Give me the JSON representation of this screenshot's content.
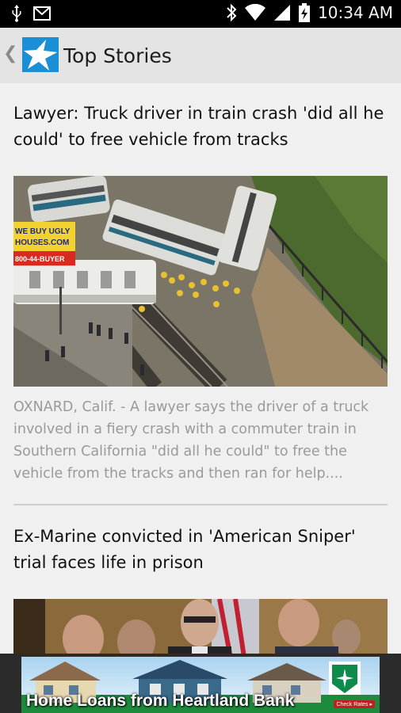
{
  "status_bar": {
    "time": "10:34 AM",
    "icons": [
      "usb-icon",
      "gmail-icon",
      "bluetooth-icon",
      "wifi-icon",
      "signal-icon",
      "battery-charging-icon"
    ]
  },
  "app_bar": {
    "back_glyph": "❮",
    "title": "Top Stories",
    "logo": "app-logo-star"
  },
  "stories": [
    {
      "headline": "Lawyer: Truck driver in train crash 'did all he could' to free vehicle from tracks",
      "image": "train-crash-aerial-photo",
      "sign_line1": "WE BUY UGLY",
      "sign_line2": "HOUSES.COM",
      "sign_line3": "800-44-BUYER",
      "summary": "OXNARD, Calif. - A lawyer says the driver of a truck involved in a fiery crash with a commuter train in Southern California \"did all he could\" to free the vehicle from the tracks and then ran for help...."
    },
    {
      "headline": "Ex-Marine convicted in 'American Sniper' trial faces life in prison",
      "image": "courtroom-photo"
    }
  ],
  "ad": {
    "text": "Home Loans from Heartland Bank",
    "cta": "Check Rates ▸",
    "brand_color": "#0e8a4a"
  },
  "colors": {
    "status_bar": "#000000",
    "app_bar": "#e4e4e4",
    "background": "#f0f0f0",
    "summary_text": "#9a9a9a",
    "logo_blue": "#1a8fd6"
  }
}
